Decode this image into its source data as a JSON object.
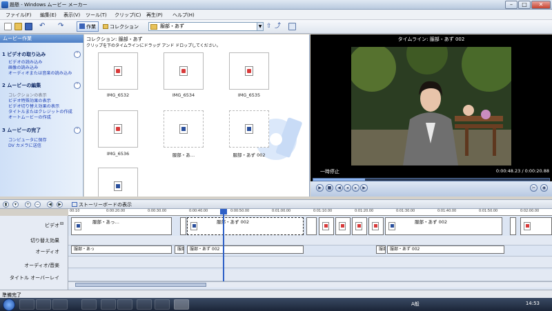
{
  "window": {
    "title": "題懸 - Windows ムービー メーカー"
  },
  "menu": [
    "ファイル(F)",
    "編集(E)",
    "表示(V)",
    "ツール(T)",
    "クリップ(C)",
    "再生(P)",
    "ヘルプ(H)"
  ],
  "toolbar": {
    "tasks_label": "作業",
    "collections_label": "コレクション",
    "collection_selected": "服部・あず"
  },
  "task_pane": {
    "header": "ムービー作業",
    "sections": [
      {
        "title": "1 ビデオの取り込み",
        "links": [
          "ビデオの読み込み",
          "画像の読み込み",
          "オーディオまたは音楽の読み込み"
        ]
      },
      {
        "title": "2 ムービーの編集",
        "links": [
          "コレクションの表示",
          "ビデオ特殊効果の表示",
          "ビデオ切り替え効果の表示",
          "タイトルまたはクレジットの作成",
          "オートムービーの作成"
        ]
      },
      {
        "title": "3 ムービーの完了",
        "links": [
          "コンピュータに保存",
          "DV カメラに送信"
        ]
      }
    ]
  },
  "collection_pane": {
    "path": "コレクション: 服部・あず",
    "hint": "クリップを下のタイムラインにドラッグ アンド ドロップしてください。",
    "clips": [
      "IMG_6532",
      "IMG_6534",
      "IMG_6535",
      "IMG_6536",
      "服部・あ…",
      "服部・あず 002",
      ""
    ]
  },
  "preview": {
    "title": "タイムライン: 服部・あず 002",
    "state": "一時停止",
    "time": "0:00:48.23 / 0:00:20.88",
    "progress": 0.22
  },
  "timeline": {
    "storyboard_label": "ストーリーボードの表示",
    "ticks": [
      "00:10",
      "0:00:20.00",
      "0:00:30.00",
      "0:00:40.00",
      "0:00:50.00",
      "0:01:00.00",
      "0:01:10.00",
      "0:01:20.00",
      "0:01:30.00",
      "0:01:40.00",
      "0:01:50.00",
      "0:02:00.00"
    ],
    "track_labels": [
      "ビデオ",
      "切り替え効果",
      "オーディオ",
      "オーディオ/音楽",
      "タイトル オーバーレイ"
    ],
    "video_clips": [
      "服部・あっ…",
      "服部・あず 002",
      "服部・あず 002"
    ],
    "audio_clips": [
      "服部・あっ",
      "服部",
      "服部・あず 002",
      "服部",
      "服部・あず 002"
    ]
  },
  "status": {
    "text": "準備完了"
  },
  "taskbar": {
    "ime": "A般",
    "clock": "14:53"
  }
}
